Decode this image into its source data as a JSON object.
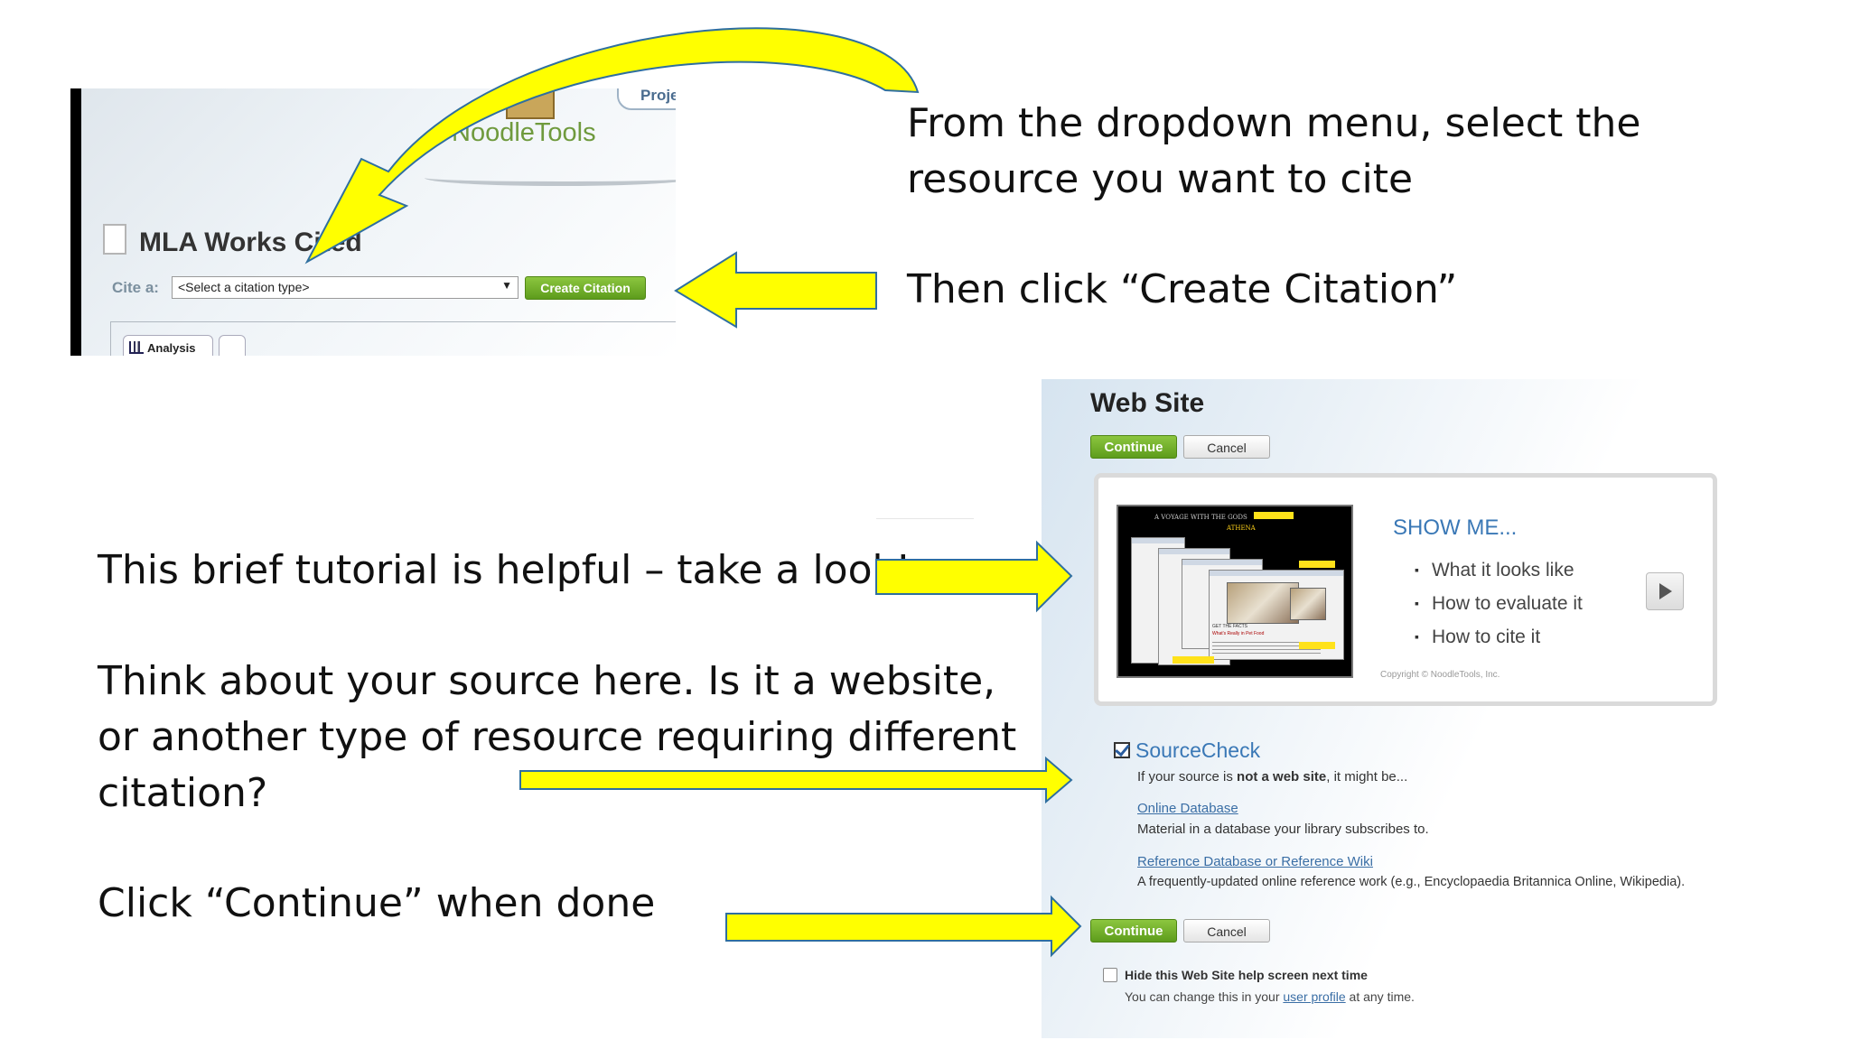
{
  "instructions": {
    "step1_line1": "From the dropdown menu, select the",
    "step1_line2": "resource you want to cite",
    "step2": "Then click “Create Citation”",
    "tutorial": "This brief tutorial is helpful – take a look!",
    "think_line1": "Think about your source here. Is it a website,",
    "think_line2": "or another type of resource requiring different",
    "think_line3": "citation?",
    "continue": "Click “Continue” when done"
  },
  "noodletools": {
    "project_tab": "Projec",
    "logo": "NoodleTools",
    "heading": "MLA Works Cited",
    "cite_label": "Cite a:",
    "select_value": "<Select a citation type>",
    "create_button": "Create Citation",
    "analysis_tab": "Analysis"
  },
  "website_form": {
    "title": "Web Site",
    "continue_button": "Continue",
    "cancel_button": "Cancel",
    "tutorial_panel": {
      "thumb_header": "A VOYAGE WITH THE GODS",
      "thumb_subheader": "ATHENA",
      "thumb_article_title": "GET THE FACTS",
      "thumb_article_link": "What's Really in Pet Food",
      "show_me": "SHOW ME...",
      "items": [
        "What it looks like",
        "How to evaluate it",
        "How to cite it"
      ],
      "copyright": "Copyright © NoodleTools, Inc."
    },
    "sourcecheck": {
      "title": "SourceCheck",
      "intro_prefix": "If your source is ",
      "intro_bold": "not a web site",
      "intro_suffix": ", it might be...",
      "option1_link": "Online Database",
      "option1_desc": "Material in a database your library subscribes to.",
      "option2_link": "Reference Database or Reference Wiki",
      "option2_desc": "A frequently-updated online reference work (e.g., Encyclopaedia Britannica Online, Wikipedia)."
    },
    "hide_label": "Hide this Web Site help screen next time",
    "hide_note_prefix": "You can change this in your ",
    "hide_note_link": "user profile",
    "hide_note_suffix": " at any time."
  },
  "colors": {
    "arrow_fill": "#ffff00",
    "arrow_stroke": "#2f6f9f",
    "button_green": "#6aaa25",
    "link_blue": "#3a78b6"
  }
}
